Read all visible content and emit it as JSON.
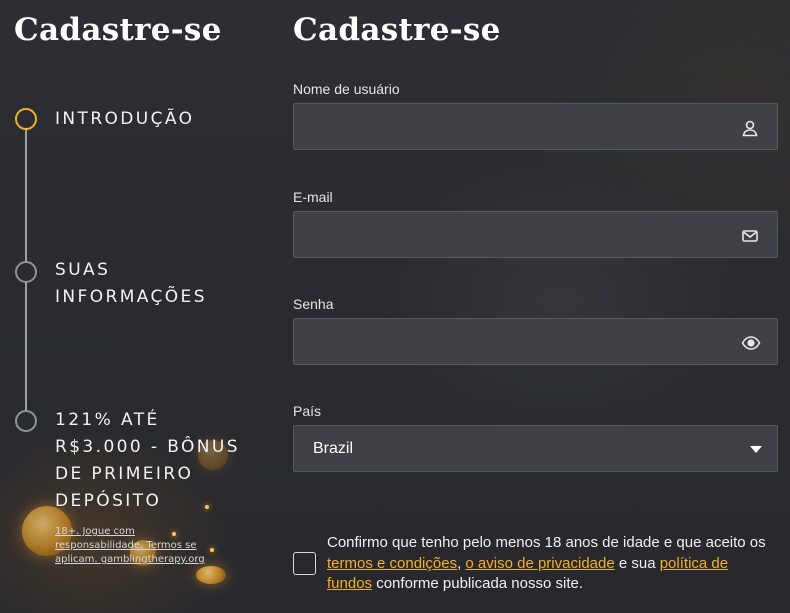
{
  "left_panel": {
    "title": "Cadastre-se",
    "steps": [
      {
        "label": "INTRODUÇÃO"
      },
      {
        "label": "SUAS INFORMAÇÕES"
      },
      {
        "label": "121% ATÉ R$3.000 - BÔNUS DE PRIMEIRO DEPÓSITO"
      }
    ],
    "disclaimer": "18+. Jogue com responsabilidade. Termos se aplicam. gamblingtherapy.org"
  },
  "form": {
    "title": "Cadastre-se",
    "username": {
      "label": "Nome de usuário",
      "value": "",
      "icon": "user-icon"
    },
    "email": {
      "label": "E-mail",
      "value": "",
      "icon": "mail-icon"
    },
    "password": {
      "label": "Senha",
      "value": "",
      "icon": "eye-icon"
    },
    "country": {
      "label": "País",
      "selected": "Brazil"
    },
    "consent": {
      "text_1": "Confirmo que tenho pelo menos 18 anos de idade e que aceito os ",
      "link_terms": "termos e condições",
      "text_2": ", ",
      "link_privacy": "o aviso de privacidade",
      "text_3": " e sua ",
      "link_funds": "política de fundos",
      "text_4": " conforme publicada nosso site."
    }
  },
  "colors": {
    "accent": "#f0b22a",
    "background": "#2b2c31",
    "field_bg": "#404147"
  }
}
